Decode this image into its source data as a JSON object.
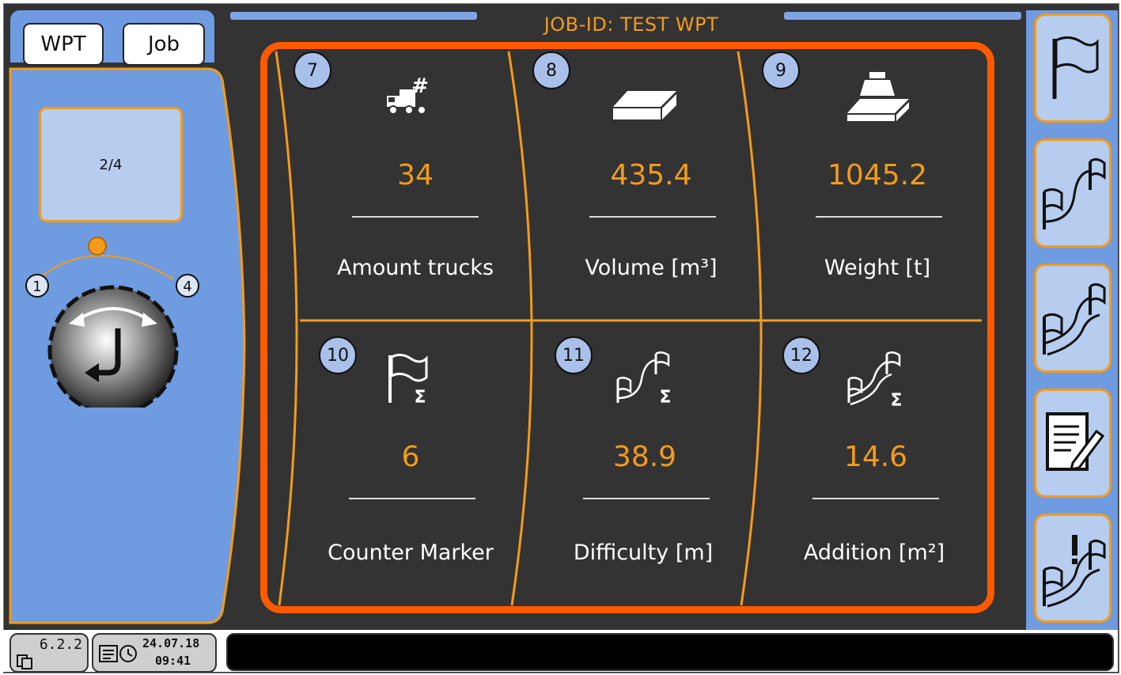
{
  "header": {
    "tabs": [
      {
        "label": "WPT"
      },
      {
        "label": "Job"
      }
    ],
    "title": "JOB-ID: TEST WPT"
  },
  "left_panel": {
    "counter": "2/4",
    "dial": {
      "min_label": "1",
      "max_label": "4",
      "icon": "enter-rotary-knob-icon"
    }
  },
  "cells": [
    {
      "number": "7",
      "icon": "truck-count-icon",
      "value": "34",
      "label": "Amount trucks"
    },
    {
      "number": "8",
      "icon": "volume-slab-icon",
      "value": "435.4",
      "label": "Volume [m³]"
    },
    {
      "number": "9",
      "icon": "weight-scale-icon",
      "value": "1045.2",
      "label": "Weight [t]"
    },
    {
      "number": "10",
      "icon": "flag-sum-icon",
      "value": "6",
      "label": "Counter Marker"
    },
    {
      "number": "11",
      "icon": "difficulty-sum-icon",
      "value": "38.9",
      "label": "Difficulty [m]"
    },
    {
      "number": "12",
      "icon": "addition-sum-icon",
      "value": "14.6",
      "label": "Addition [m²]"
    }
  ],
  "right_buttons": [
    {
      "icon": "flag-icon"
    },
    {
      "icon": "difficulty-flag-icon"
    },
    {
      "icon": "addition-flag-icon"
    },
    {
      "icon": "notepad-edit-icon"
    },
    {
      "icon": "warning-flag-icon"
    }
  ],
  "status": {
    "version": "6.2.2",
    "date": "24.07.18",
    "time": "09:41"
  },
  "colors": {
    "accent": "#f39b1c",
    "frame": "#ff5a00",
    "panel_blue": "#6f9be0",
    "background": "#333333"
  }
}
